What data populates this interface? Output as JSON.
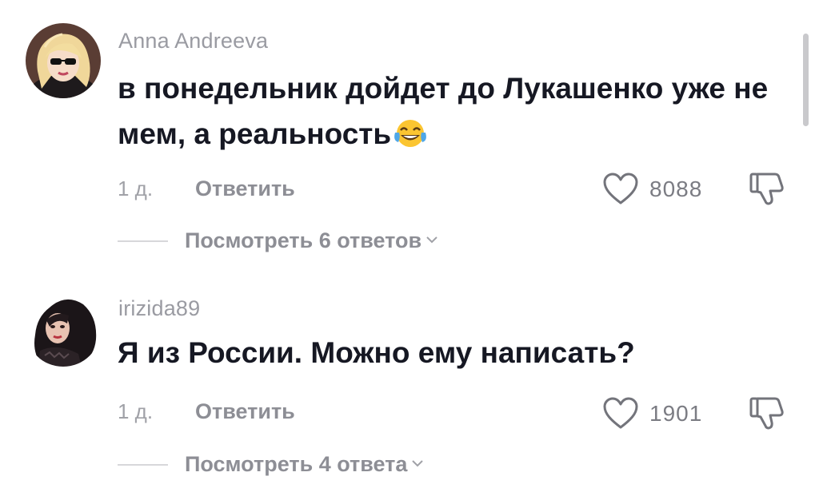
{
  "comments": [
    {
      "username": "Anna Andreeva",
      "text": "в понедельник дойдет до Лукашенко уже не мем, а реальность",
      "emoji": "face-with-tears-of-joy",
      "time": "1 д.",
      "reply_label": "Ответить",
      "likes": "8088",
      "replies_label": "Посмотреть 6 ответов"
    },
    {
      "username": "irizida89",
      "text": "Я из России. Можно ему написать?",
      "time": "1 д.",
      "reply_label": "Ответить",
      "likes": "1901",
      "replies_label": "Посмотреть 4 ответа"
    }
  ],
  "icons": {
    "like": "heart-outline-icon",
    "dislike": "thumbs-down-outline-icon",
    "expand": "chevron-down-icon"
  },
  "colors": {
    "text": "#161823",
    "muted": "#9a9ba2",
    "scrollbar": "#c9c9cc"
  }
}
